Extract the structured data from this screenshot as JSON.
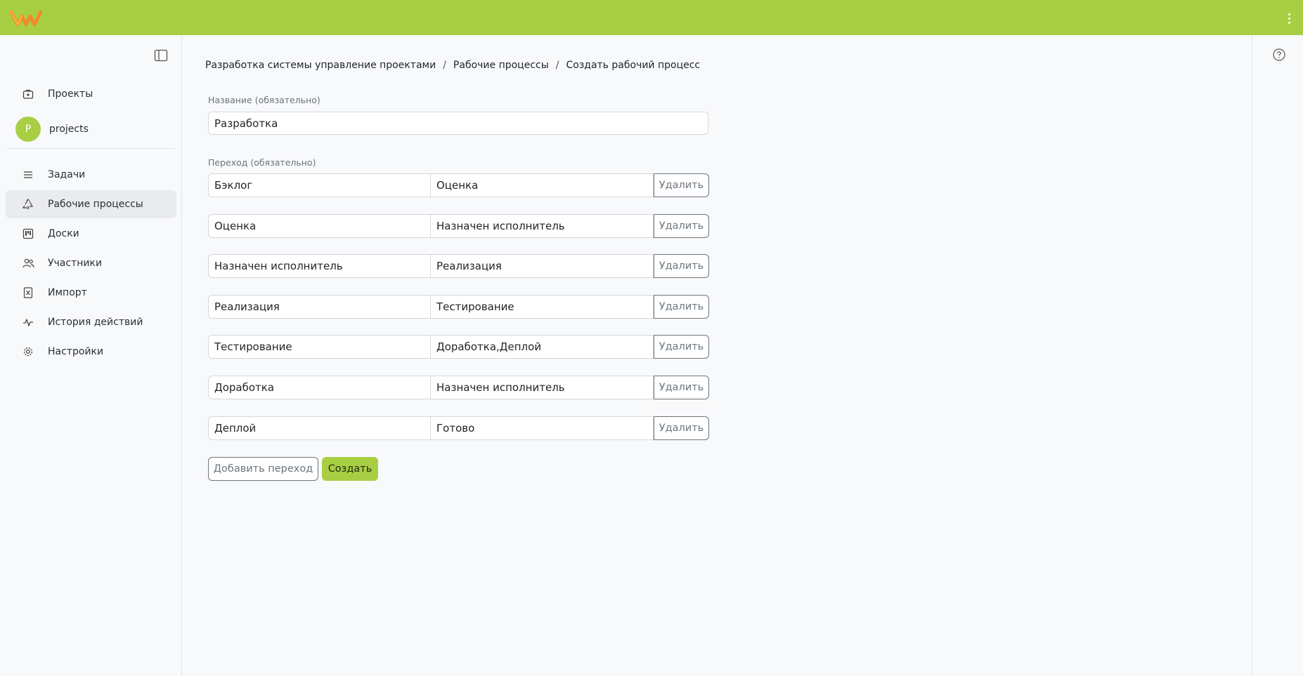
{
  "brand": {
    "accent": "#a8cf44",
    "logo": "w-logo"
  },
  "sidebar": {
    "projects_label": "Проекты",
    "project": {
      "initial": "P",
      "name": "projects"
    },
    "items": [
      {
        "label": "Задачи",
        "icon": "list-icon"
      },
      {
        "label": "Рабочие процессы",
        "icon": "recycle-icon",
        "active": true
      },
      {
        "label": "Доски",
        "icon": "board-icon"
      },
      {
        "label": "Участники",
        "icon": "users-icon"
      },
      {
        "label": "Импорт",
        "icon": "import-icon"
      },
      {
        "label": "История действий",
        "icon": "activity-icon"
      },
      {
        "label": "Настройки",
        "icon": "gear-icon"
      }
    ]
  },
  "breadcrumb": [
    "Разработка системы управление проектами",
    "Рабочие процессы",
    "Создать рабочий процесс"
  ],
  "form": {
    "name_label": "Название (обязательно)",
    "name_value": "Разработка",
    "transition_label": "Переход (обязательно)",
    "delete_label": "Удалить",
    "transitions": [
      {
        "from": "Бэклог",
        "to": "Оценка"
      },
      {
        "from": "Оценка",
        "to": "Назначен исполнитель"
      },
      {
        "from": "Назначен исполнитель",
        "to": "Реализация"
      },
      {
        "from": "Реализация",
        "to": "Тестирование"
      },
      {
        "from": "Тестирование",
        "to": "Доработка,Деплой"
      },
      {
        "from": "Доработка",
        "to": "Назначен исполнитель"
      },
      {
        "from": "Деплой",
        "to": "Готово"
      }
    ],
    "add_label": "Добавить переход",
    "create_label": "Создать"
  }
}
